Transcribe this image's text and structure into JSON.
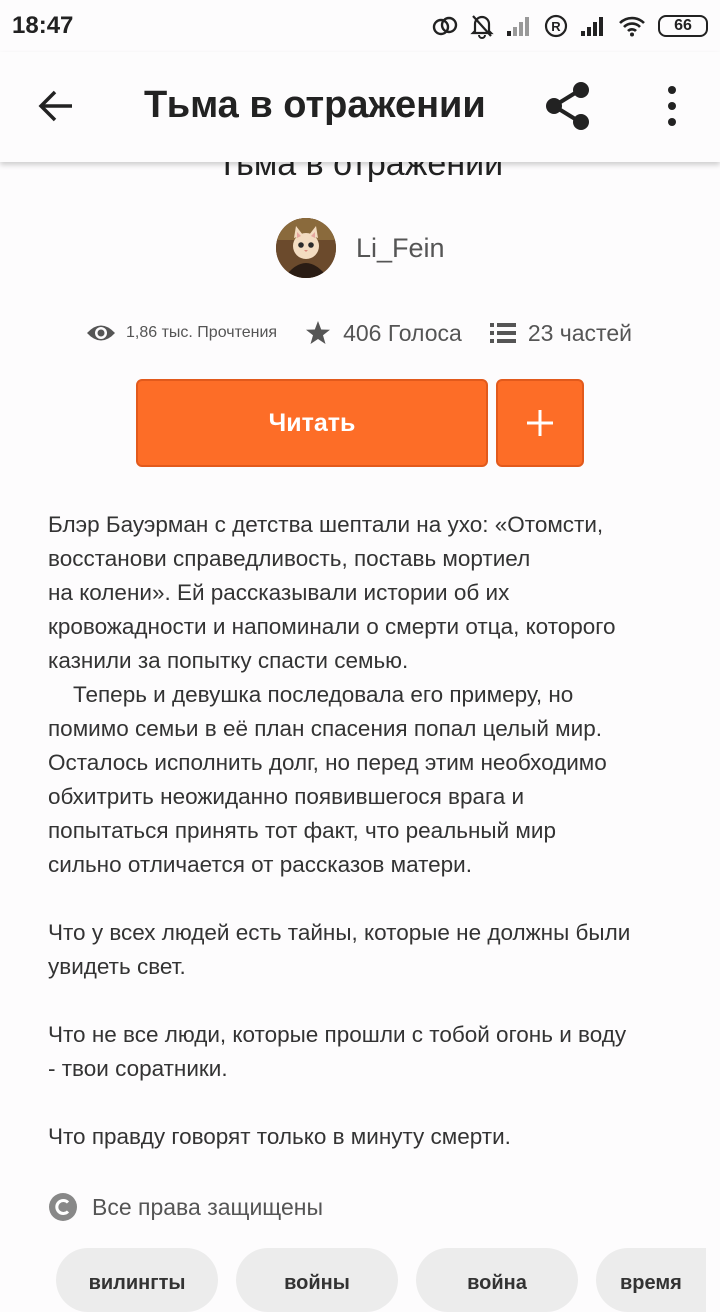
{
  "status_bar": {
    "time": "18:47",
    "battery": "66"
  },
  "app_bar": {
    "title": "Тьма в отражении"
  },
  "story": {
    "title": "Тьма в отражении",
    "author": "Li_Fein",
    "reads": "1,86 тыс. Прочтения",
    "votes": "406 Голоса",
    "parts": "23 частей"
  },
  "actions": {
    "read": "Читать"
  },
  "description": {
    "lines_1": [
      "Блэр Бауэрман с детства шептали на ухо: «Отомсти,",
      "восстанови справедливость, поставь мортиел",
      "на колени». Ей рассказывали истории об их",
      "кровожадности и напоминали о смерти отца, которого",
      "казнили за попытку спасти семью.",
      "    Теперь и девушка последовала его примеру, но",
      "помимо семьи в её план спасения попал целый мир.",
      "Осталось исполнить долг, но перед этим необходимо",
      "обхитрить неожиданно появившегося врага и",
      "попытаться принять тот факт, что реальный мир",
      "сильно отличается от рассказов матери."
    ],
    "lines_2": [
      "Что у всех людей есть тайны, которые не должны были",
      "увидеть свет."
    ],
    "lines_3": [
      "Что не все люди, которые прошли с тобой огонь и воду",
      "- твои соратники."
    ],
    "lines_4": [
      "Что правду говорят только в минуту смерти."
    ]
  },
  "copyright": "Все права защищены",
  "tags": [
    "вилингты",
    "войны",
    "война",
    "время"
  ],
  "icons": {
    "back": "arrow-left-icon",
    "share": "share-icon",
    "more": "more-vertical-icon",
    "eye": "eye-icon",
    "star": "star-icon",
    "list": "list-icon",
    "plus": "plus-icon",
    "copyright": "copyright-icon"
  },
  "colors": {
    "accent": "#fd6d27",
    "text": "#333333",
    "muted": "#555555"
  }
}
